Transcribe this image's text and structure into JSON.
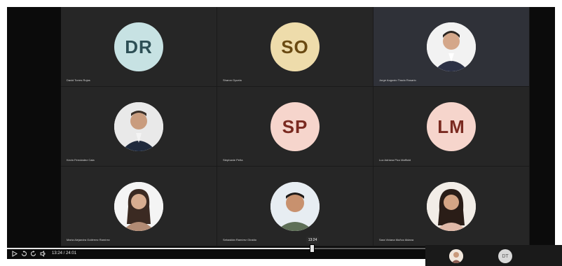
{
  "participants": [
    {
      "initials": "DR",
      "name": "David Torres Rojas",
      "avatar_bg": "#c7e2e3",
      "avatar_fg": "#2d4f55"
    },
    {
      "initials": "SO",
      "name": "Sharon Oyuela",
      "avatar_bg": "#eedcab",
      "avatar_fg": "#6a4a12"
    },
    {
      "initials": "",
      "name": "Jorge Augusto Tirado Rosario",
      "avatar_bg": "#ffffff",
      "avatar_fg": "#333333",
      "photo": true
    },
    {
      "initials": "",
      "name": "Kevin Fernández Cala",
      "avatar_bg": "#ffffff",
      "avatar_fg": "#333333",
      "photo": true
    },
    {
      "initials": "SP",
      "name": "Stephanie Peña",
      "avatar_bg": "#f6d5cc",
      "avatar_fg": "#7a2a20"
    },
    {
      "initials": "LM",
      "name": "Luz Adriana Pico Maffiold",
      "avatar_bg": "#f6d5cc",
      "avatar_fg": "#7a2a20"
    },
    {
      "initials": "",
      "name": "María Alejandra Gutiérrez Ramírez",
      "avatar_bg": "#ffffff",
      "avatar_fg": "#333333",
      "photo": true
    },
    {
      "initials": "",
      "name": "Sebastián Ramírez Giraldo",
      "avatar_bg": "#ffffff",
      "avatar_fg": "#333333",
      "photo": true
    },
    {
      "initials": "",
      "name": "Sara Viviana Muñoz Aldana",
      "avatar_bg": "#ffffff",
      "avatar_fg": "#333333",
      "photo": true
    }
  ],
  "player": {
    "current_time": "13:24",
    "duration": "24:01",
    "time_display": "13:24 / 24:01",
    "progress": 0.558
  },
  "thumbnail_strip": {
    "initials": "DT"
  }
}
